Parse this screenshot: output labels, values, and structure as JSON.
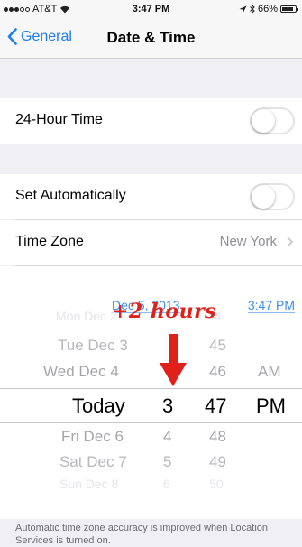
{
  "status_bar": {
    "carrier": "AT&T",
    "time": "3:47 PM",
    "battery": "66%"
  },
  "nav": {
    "back_label": "General",
    "title": "Date & Time"
  },
  "settings": {
    "hour24_label": "24-Hour Time",
    "hour24_on": false,
    "set_auto_label": "Set Automatically",
    "set_auto_on": false,
    "timezone_label": "Time Zone",
    "timezone_value": "New York"
  },
  "date_display": {
    "date": "Dec 5, 2013",
    "time": "3:47 PM"
  },
  "annotation": {
    "text": "+2 hours",
    "color": "#e0201a"
  },
  "picker": {
    "days": [
      "Mon Dec 2",
      "Tue Dec 3",
      "Wed Dec 4",
      "Today",
      "Fri Dec 6",
      "Sat Dec 7",
      "Sun Dec 8"
    ],
    "hours": [
      "",
      "",
      "",
      "3",
      "4",
      "5",
      "6"
    ],
    "minutes": [
      "44",
      "45",
      "46",
      "47",
      "48",
      "49",
      "50"
    ],
    "ampm": [
      "",
      "",
      "AM",
      "PM",
      "",
      "",
      ""
    ]
  },
  "footer": {
    "note": "Automatic time zone accuracy is improved when Location Services is turned on."
  },
  "colors": {
    "accent": "#1e7cf5",
    "date_blue": "#3b8ee9"
  }
}
